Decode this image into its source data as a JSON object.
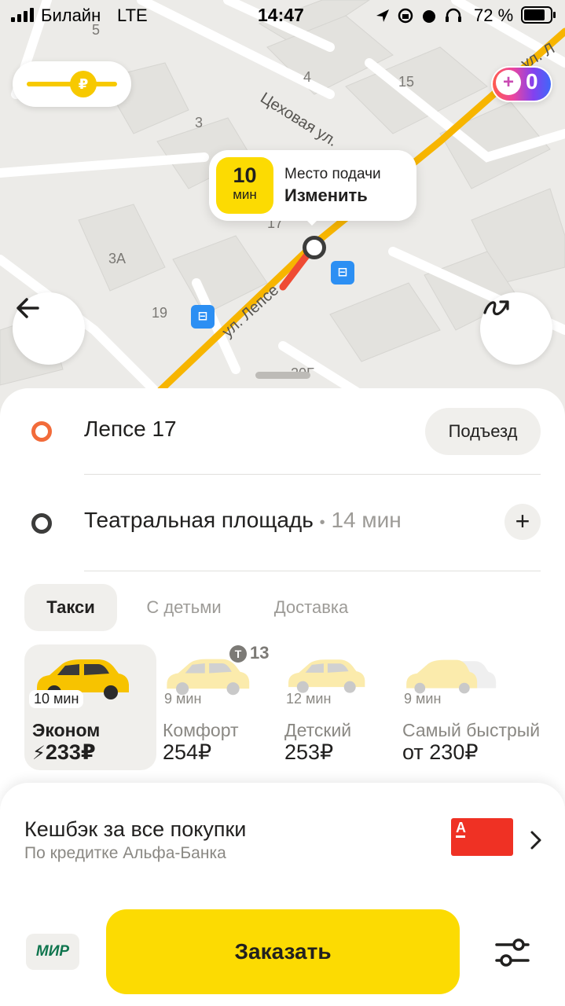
{
  "status_bar": {
    "carrier": "Билайн",
    "network": "LTE",
    "time": "14:47",
    "battery": "72 %"
  },
  "map": {
    "street_labels": [
      "ул. Лепсе",
      "Цеховая ул.",
      "ул. Л"
    ],
    "house_numbers": [
      "5",
      "4",
      "15",
      "3",
      "3А",
      "17",
      "19",
      "20Г"
    ],
    "cashback_coin": "₽",
    "plus_points": "0",
    "pickup_tooltip": {
      "eta_value": "10",
      "eta_unit": "мин",
      "title": "Место подачи",
      "action": "Изменить"
    }
  },
  "route": {
    "from": "Лепсе 17",
    "entrance_button": "Подъезд",
    "to": "Театральная площадь",
    "to_duration": "14 мин",
    "separator": "•"
  },
  "tabs": [
    {
      "label": "Такси",
      "active": true
    },
    {
      "label": "С детьми",
      "active": false
    },
    {
      "label": "Доставка",
      "active": false
    }
  ],
  "promo_count": "13",
  "tariffs": [
    {
      "eta": "10 мин",
      "name": "Эконом",
      "price": "233₽",
      "selected": true,
      "surge": true
    },
    {
      "eta": "9 мин",
      "name": "Комфорт",
      "price": "254₽",
      "selected": false
    },
    {
      "eta": "12 мин",
      "name": "Детский",
      "price": "253₽",
      "selected": false
    },
    {
      "eta": "9 мин",
      "name": "Самый быстрый",
      "price": "от 230₽",
      "selected": false
    }
  ],
  "cashback": {
    "title": "Кешбэк за все покупки",
    "subtitle": "По кредитке Альфа-Банка",
    "bank_logo_letter": "А"
  },
  "payment": {
    "method": "МИР",
    "order_button": "Заказать"
  },
  "colors": {
    "accent_yellow": "#fcdb02",
    "route_orange": "#f7b500",
    "origin_dot": "#f26b3a",
    "bus_stop": "#2c8ff3"
  }
}
